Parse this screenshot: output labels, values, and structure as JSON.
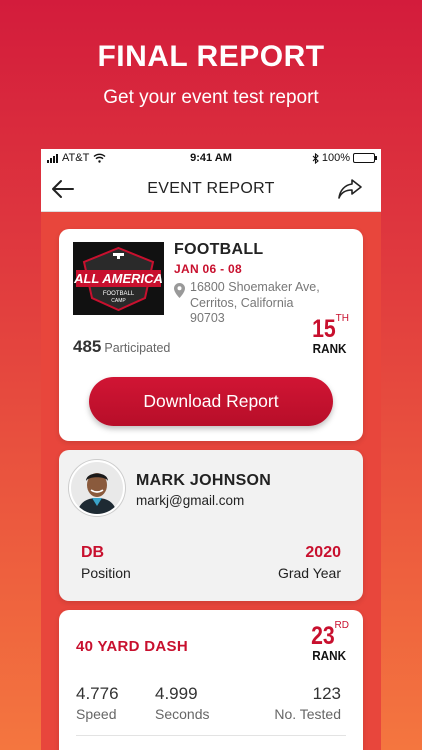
{
  "hero": {
    "title": "FINAL REPORT",
    "subtitle": "Get your event test report"
  },
  "status_bar": {
    "carrier": "AT&T",
    "time": "9:41 AM",
    "battery": "100%"
  },
  "nav": {
    "title": "EVENT REPORT",
    "back_icon": "arrow-left-icon",
    "share_icon": "share-icon"
  },
  "event": {
    "sport": "FOOTBALL",
    "dates": "JAN 06 - 08",
    "address_line1": "16800 Shoemaker Ave,",
    "address_line2": "Cerritos, California",
    "address_line3": "90703",
    "participated_count": "485",
    "participated_label": "Participated",
    "rank": "15",
    "rank_suffix": "TH",
    "rank_label": "RANK",
    "download_label": "Download Report",
    "logo": {
      "line1": "ALL AMERICA",
      "line2": "FOOTBALL",
      "line3": "CAMP"
    }
  },
  "player": {
    "name": "MARK JOHNSON",
    "email": "markj@gmail.com",
    "position": "DB",
    "position_label": "Position",
    "grad_year": "2020",
    "grad_year_label": "Grad Year"
  },
  "test": {
    "name": "40 YARD DASH",
    "rank": "23",
    "rank_suffix": "RD",
    "rank_label": "RANK",
    "stats": [
      {
        "value": "4.776",
        "label": "Speed"
      },
      {
        "value": "4.999",
        "label": "Seconds"
      },
      {
        "value": "123",
        "label": "No. Tested"
      }
    ]
  },
  "colors": {
    "accent": "#c8102e",
    "gradient_top": "#d31c3c",
    "gradient_bottom": "#f4763f"
  }
}
